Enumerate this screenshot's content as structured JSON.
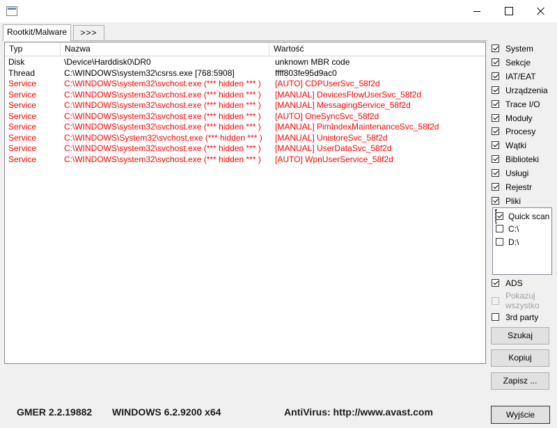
{
  "window": {
    "icon": "app-window-icon"
  },
  "tabs": [
    {
      "label": "Rootkit/Malware"
    },
    {
      "label": ">>>"
    }
  ],
  "table": {
    "columns": [
      "Typ",
      "Nazwa",
      "Wartość"
    ],
    "rows": [
      {
        "typ": "Disk",
        "nazwa": "\\Device\\Harddisk0\\DR0",
        "wartosc": "unknown MBR code",
        "highlight": false
      },
      {
        "typ": "Thread",
        "nazwa": "C:\\WINDOWS\\system32\\csrss.exe [768:5908]",
        "wartosc": "ffff803fe95d9ac0",
        "highlight": false
      },
      {
        "typ": "Service",
        "nazwa": "C:\\WINDOWS\\system32\\svchost.exe (*** hidden *** )",
        "wartosc": "[AUTO] CDPUserSvc_58f2d",
        "highlight": true
      },
      {
        "typ": "Service",
        "nazwa": "C:\\WINDOWS\\system32\\svchost.exe (*** hidden *** )",
        "wartosc": "[MANUAL] DevicesFlowUserSvc_58f2d",
        "highlight": true
      },
      {
        "typ": "Service",
        "nazwa": "C:\\WINDOWS\\system32\\svchost.exe (*** hidden *** )",
        "wartosc": "[MANUAL] MessagingService_58f2d",
        "highlight": true
      },
      {
        "typ": "Service",
        "nazwa": "C:\\WINDOWS\\system32\\svchost.exe (*** hidden *** )",
        "wartosc": "[AUTO] OneSyncSvc_58f2d",
        "highlight": true
      },
      {
        "typ": "Service",
        "nazwa": "C:\\WINDOWS\\system32\\svchost.exe (*** hidden *** )",
        "wartosc": "[MANUAL] PimIndexMaintenanceSvc_58f2d",
        "highlight": true
      },
      {
        "typ": "Service",
        "nazwa": "C:\\WINDOWS\\System32\\svchost.exe (*** hidden *** )",
        "wartosc": "[MANUAL] UnistoreSvc_58f2d",
        "highlight": true
      },
      {
        "typ": "Service",
        "nazwa": "C:\\WINDOWS\\system32\\svchost.exe (*** hidden *** )",
        "wartosc": "[MANUAL] UserDataSvc_58f2d",
        "highlight": true
      },
      {
        "typ": "Service",
        "nazwa": "C:\\WINDOWS\\system32\\svchost.exe (*** hidden *** )",
        "wartosc": "[AUTO] WpnUserService_58f2d",
        "highlight": true
      }
    ]
  },
  "options": [
    {
      "label": "System",
      "checked": true
    },
    {
      "label": "Sekcje",
      "checked": true
    },
    {
      "label": "IAT/EAT",
      "checked": true
    },
    {
      "label": "Urządzenia",
      "checked": true
    },
    {
      "label": "Trace I/O",
      "checked": true
    },
    {
      "label": "Moduły",
      "checked": true
    },
    {
      "label": "Procesy",
      "checked": true
    },
    {
      "label": "Wątki",
      "checked": true
    },
    {
      "label": "Biblioteki",
      "checked": true
    },
    {
      "label": "Usługi",
      "checked": true
    },
    {
      "label": "Rejestr",
      "checked": true
    },
    {
      "label": "Pliki",
      "checked": true
    }
  ],
  "scan_targets": [
    {
      "label": "Quick scan",
      "checked": true
    },
    {
      "label": "C:\\",
      "checked": false
    },
    {
      "label": "D:\\",
      "checked": false
    }
  ],
  "extra_options": {
    "ads": {
      "label": "ADS",
      "checked": true
    },
    "show_all": {
      "label_line1": "Pokazuj",
      "label_line2": "wszystko",
      "checked": false,
      "disabled": true
    },
    "third_party": {
      "label": "3rd party",
      "checked": false
    }
  },
  "buttons": {
    "scan": "Szukaj",
    "copy": "Kopiuj",
    "save": "Zapisz ...",
    "exit": "Wyjście"
  },
  "status": {
    "version": "GMER 2.2.19882",
    "os": "WINDOWS 6.2.9200  x64",
    "antivirus": "AntiVirus: http://www.avast.com"
  },
  "colors": {
    "hidden_row": "#ff0000"
  }
}
